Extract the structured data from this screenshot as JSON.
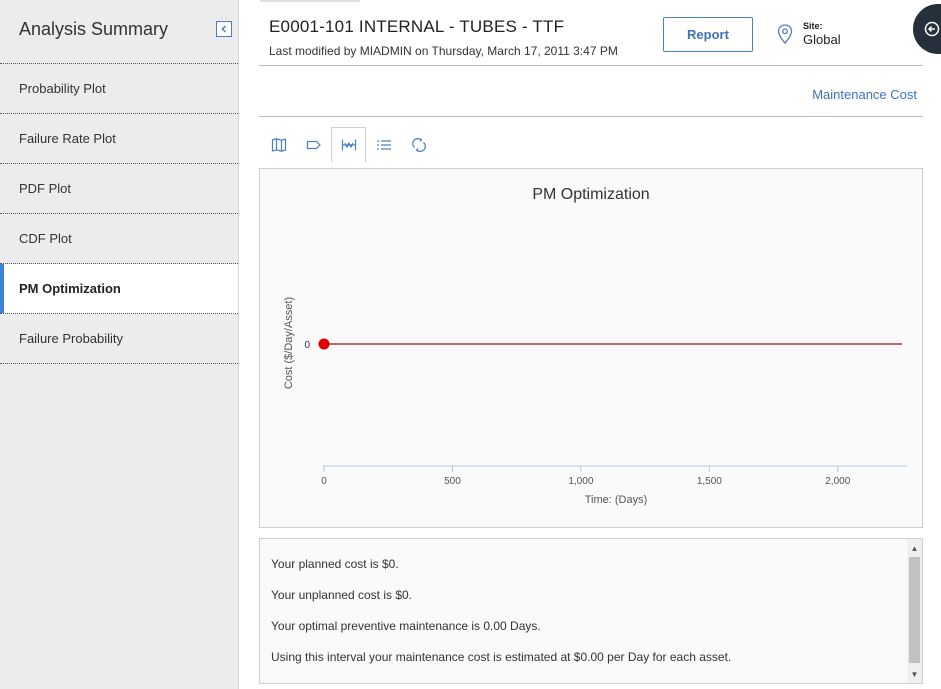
{
  "sidebar": {
    "title": "Analysis Summary",
    "items": [
      {
        "label": "Probability Plot",
        "active": false
      },
      {
        "label": "Failure Rate Plot",
        "active": false
      },
      {
        "label": "PDF Plot",
        "active": false
      },
      {
        "label": "CDF Plot",
        "active": false
      },
      {
        "label": "PM Optimization",
        "active": true
      },
      {
        "label": "Failure Probability",
        "active": false
      }
    ]
  },
  "header": {
    "title": "E0001-101 INTERNAL - TUBES - TTF",
    "subtitle": "Last modified by MIADMIN on Thursday, March 17, 2011 3:47 PM",
    "report_label": "Report",
    "site_label": "Site:",
    "site_value": "Global"
  },
  "links": {
    "maintenance_cost": "Maintenance Cost"
  },
  "toolbar": {
    "icons": [
      "map-icon",
      "tag-icon",
      "range-icon",
      "list-icon",
      "refresh-icon"
    ],
    "active_index": 2
  },
  "colors": {
    "accent": "#3d82d6",
    "link": "#3d73b9",
    "series_line": "#8b1a1a",
    "series_point": "#e00000"
  },
  "chart_data": {
    "type": "line",
    "title": "PM Optimization",
    "xlabel": "Time: (Days)",
    "ylabel": "Cost ($/Day/Asset)",
    "x_ticks": [
      0,
      500,
      1000,
      1500,
      2000
    ],
    "x_tick_labels": [
      "0",
      "500",
      "1,000",
      "1,500",
      "2,000"
    ],
    "y_ticks": [
      0
    ],
    "y_tick_labels": [
      "0"
    ],
    "xlim": [
      0,
      2250
    ],
    "series": [
      {
        "x": [
          0,
          2250
        ],
        "y": [
          0,
          0
        ]
      }
    ],
    "highlight_point": {
      "x": 0,
      "y": 0
    }
  },
  "messages": [
    "Your planned cost is $0.",
    "Your unplanned cost is $0.",
    "Your optimal preventive maintenance is 0.00 Days.",
    "Using this interval your maintenance cost is estimated at $0.00 per Day for each asset."
  ]
}
